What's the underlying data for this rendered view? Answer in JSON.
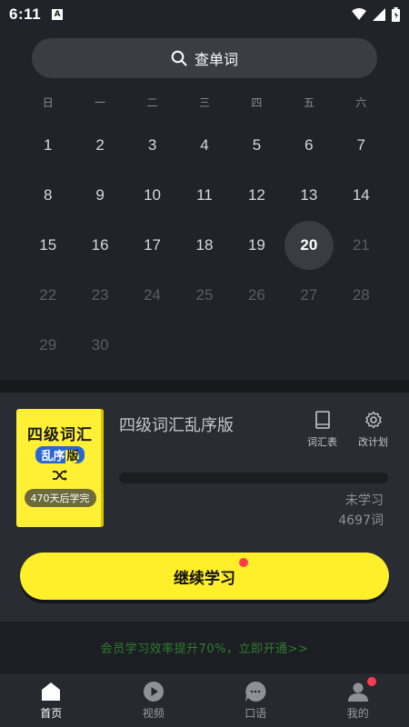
{
  "status": {
    "time": "6:11",
    "a_badge": "A",
    "icons": [
      "wifi-icon",
      "signal-icon",
      "battery-icon"
    ]
  },
  "search": {
    "placeholder": "查单词",
    "icon": "search-icon"
  },
  "calendar": {
    "weekdays": [
      "日",
      "一",
      "二",
      "三",
      "四",
      "五",
      "六"
    ],
    "days": [
      {
        "label": "1",
        "dim": false
      },
      {
        "label": "2",
        "dim": false
      },
      {
        "label": "3",
        "dim": false
      },
      {
        "label": "4",
        "dim": false
      },
      {
        "label": "5",
        "dim": false
      },
      {
        "label": "6",
        "dim": false
      },
      {
        "label": "7",
        "dim": false
      },
      {
        "label": "8",
        "dim": false
      },
      {
        "label": "9",
        "dim": false
      },
      {
        "label": "10",
        "dim": false
      },
      {
        "label": "11",
        "dim": false
      },
      {
        "label": "12",
        "dim": false
      },
      {
        "label": "13",
        "dim": false
      },
      {
        "label": "14",
        "dim": false
      },
      {
        "label": "15",
        "dim": false
      },
      {
        "label": "16",
        "dim": false
      },
      {
        "label": "17",
        "dim": false
      },
      {
        "label": "18",
        "dim": false
      },
      {
        "label": "19",
        "dim": false
      },
      {
        "label": "20",
        "dim": false,
        "today": true
      },
      {
        "label": "21",
        "dim": true
      },
      {
        "label": "22",
        "dim": true
      },
      {
        "label": "23",
        "dim": true
      },
      {
        "label": "24",
        "dim": true
      },
      {
        "label": "25",
        "dim": true
      },
      {
        "label": "26",
        "dim": true
      },
      {
        "label": "27",
        "dim": true
      },
      {
        "label": "28",
        "dim": true
      },
      {
        "label": "29",
        "dim": true
      },
      {
        "label": "30",
        "dim": true
      }
    ]
  },
  "book": {
    "cover_title": "四级词汇",
    "cover_sub": "乱序",
    "cover_sub_suffix": "版",
    "cover_badge": "470天后学完",
    "title": "四级词汇乱序版",
    "vocab_label": "词汇表",
    "plan_label": "改计划",
    "progress": 0.0,
    "status_label": "未学习",
    "word_count": "4697词"
  },
  "continue_label": "继续学习",
  "promo_text": "会员学习效率提升70%，立即开通>>",
  "nav": [
    {
      "label": "首页",
      "icon": "home-icon",
      "active": true
    },
    {
      "label": "视频",
      "icon": "play-icon",
      "active": false
    },
    {
      "label": "口语",
      "icon": "chat-icon",
      "active": false
    },
    {
      "label": "我的",
      "icon": "user-icon",
      "active": false
    }
  ],
  "colors": {
    "accent": "#ffef2b",
    "background": "#20232a",
    "notification": "#ff3b4e",
    "promo": "#2e7d2e"
  }
}
